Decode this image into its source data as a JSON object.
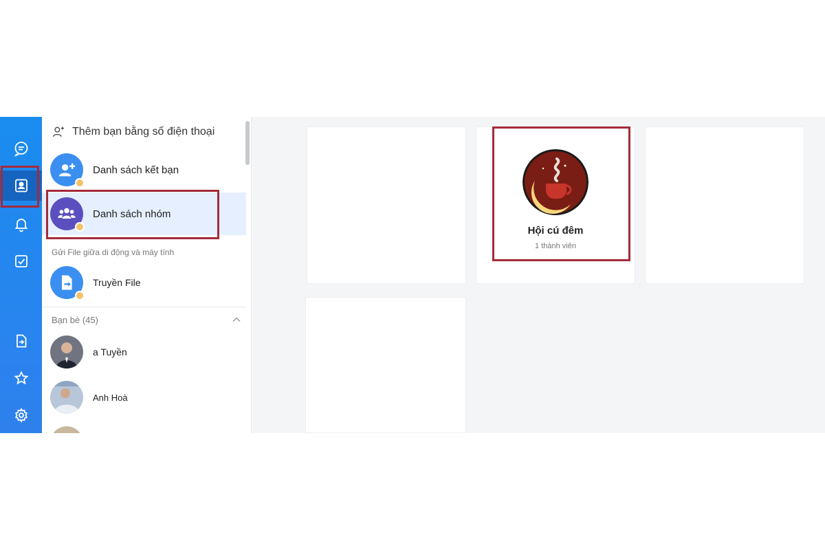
{
  "rail": {
    "items": [
      {
        "icon": "chat-icon"
      },
      {
        "icon": "contacts-icon",
        "active": true
      },
      {
        "icon": "bell-icon"
      },
      {
        "icon": "todo-check-icon"
      },
      {
        "icon": "file-transfer-icon"
      },
      {
        "icon": "star-icon"
      },
      {
        "icon": "gear-icon"
      }
    ],
    "accent": "#1a8cf0"
  },
  "panel": {
    "add_phone_label": "Thêm bạn bằng số điện thoại",
    "friend_list_label": "Danh sách kết bạn",
    "group_list_label": "Danh sách nhóm",
    "file_section_label": "Gửi File giữa di động và máy tính",
    "file_transfer_label": "Truyền File",
    "friends_section_label": "Bạn bè (45)",
    "friends": [
      {
        "name": "a Tuyền"
      },
      {
        "name": "Anh Hoà"
      }
    ]
  },
  "main": {
    "groups": [
      {
        "name": "Hội cú đêm",
        "members": "1 thành viên"
      }
    ]
  },
  "colors": {
    "highlight": "#a52a3a",
    "selected_bg": "#e5efff"
  }
}
